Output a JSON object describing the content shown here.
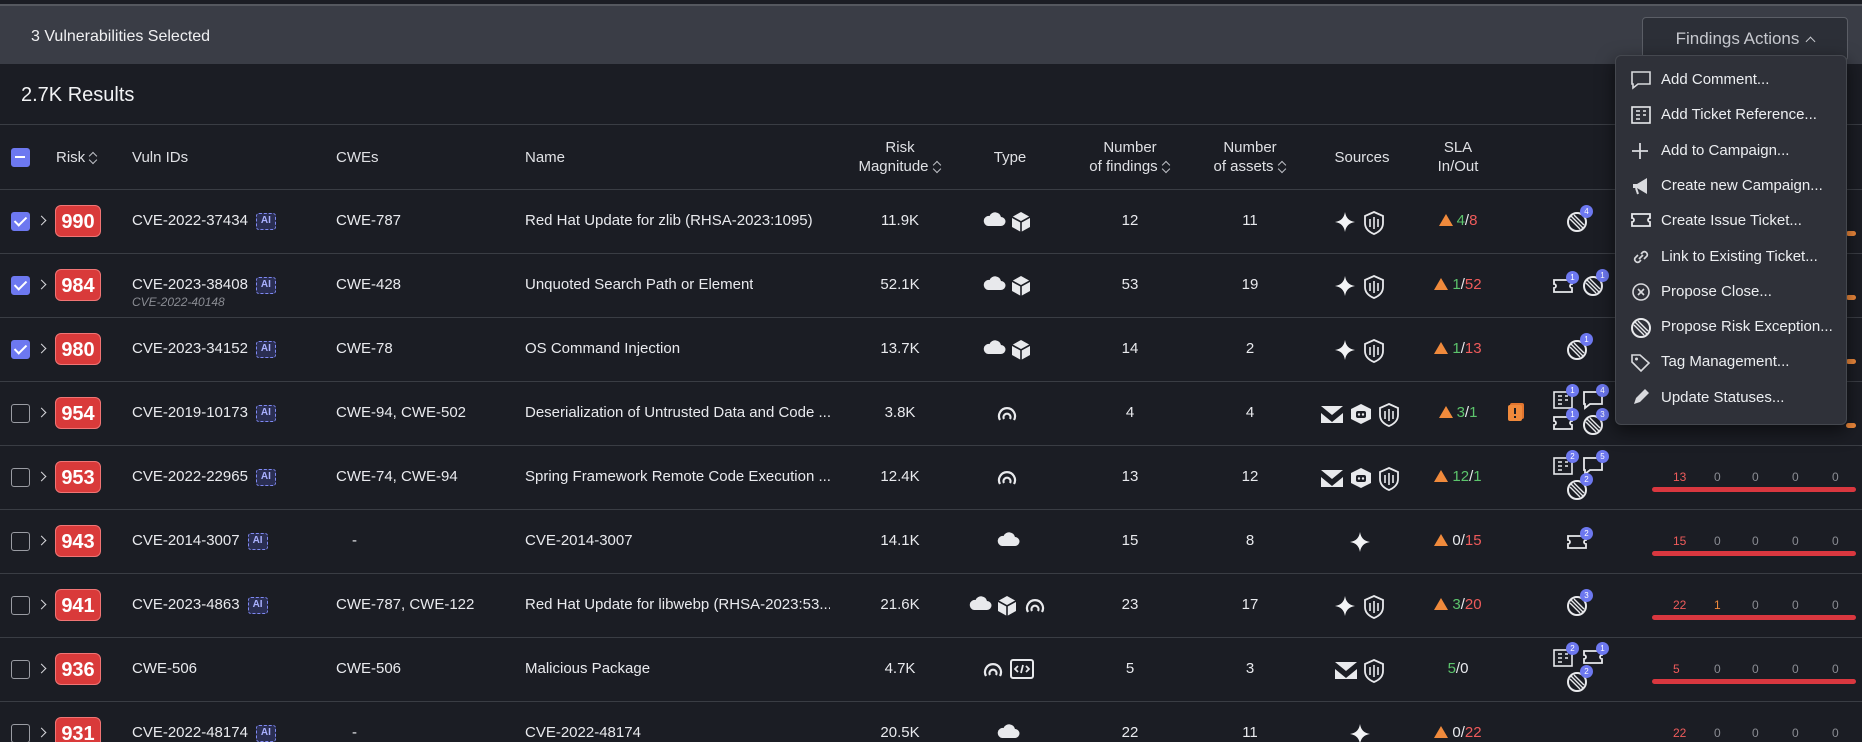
{
  "selection_bar": {
    "text": "3 Vulnerabilities Selected",
    "actions_label": "Findings Actions"
  },
  "results_label": "2.7K Results",
  "columns": {
    "risk": "Risk",
    "vuln_ids": "Vuln IDs",
    "cwes": "CWEs",
    "name": "Name",
    "risk_magnitude_1": "Risk",
    "risk_magnitude_2": "Magnitude",
    "type": "Type",
    "findings_1": "Number",
    "findings_2": "of findings",
    "assets_1": "Number",
    "assets_2": "of assets",
    "sources": "Sources",
    "sla_1": "SLA",
    "sla_2": "In/Out"
  },
  "menu": [
    {
      "label": "Add Comment...",
      "icon": "comment-icon"
    },
    {
      "label": "Add Ticket Reference...",
      "icon": "ticket-reference-icon"
    },
    {
      "label": "Add to Campaign...",
      "icon": "plus-icon"
    },
    {
      "label": "Create new Campaign...",
      "icon": "megaphone-icon"
    },
    {
      "label": "Create Issue Ticket...",
      "icon": "ticket-icon"
    },
    {
      "label": "Link to Existing Ticket...",
      "icon": "link-icon"
    },
    {
      "label": "Propose Close...",
      "icon": "close-circle-icon"
    },
    {
      "label": "Propose Risk Exception...",
      "icon": "risk-exception-icon"
    },
    {
      "label": "Tag Management...",
      "icon": "tag-icon"
    },
    {
      "label": "Update Statuses...",
      "icon": "pencil-icon"
    }
  ],
  "rows": [
    {
      "risk": "990",
      "vuln_id": "CVE-2022-37434",
      "alt_id": "",
      "cwes": "CWE-787",
      "name": "Red Hat Update for zlib (RHSA-2023:1095)",
      "magnitude": "11.9K",
      "findings": "12",
      "assets": "11",
      "sla_in": "4",
      "sla_out": "8",
      "checked": true
    },
    {
      "risk": "984",
      "vuln_id": "CVE-2023-38408",
      "alt_id": "CVE-2022-40148",
      "cwes": "CWE-428",
      "name": "Unquoted Search Path or Element",
      "magnitude": "52.1K",
      "findings": "53",
      "assets": "19",
      "sla_in": "1",
      "sla_out": "52",
      "checked": true
    },
    {
      "risk": "980",
      "vuln_id": "CVE-2023-34152",
      "alt_id": "",
      "cwes": "CWE-78",
      "name": "OS Command Injection",
      "magnitude": "13.7K",
      "findings": "14",
      "assets": "2",
      "sla_in": "1",
      "sla_out": "13",
      "checked": true
    },
    {
      "risk": "954",
      "vuln_id": "CVE-2019-10173",
      "alt_id": "",
      "cwes": "CWE-94, CWE-502",
      "name": "Deserialization of Untrusted Data and Code ...",
      "magnitude": "3.8K",
      "findings": "4",
      "assets": "4",
      "sla_in": "3",
      "sla_out": "1",
      "checked": false
    },
    {
      "risk": "953",
      "vuln_id": "CVE-2022-22965",
      "alt_id": "",
      "cwes": "CWE-74, CWE-94",
      "name": "Spring Framework Remote Code Execution ...",
      "magnitude": "12.4K",
      "findings": "13",
      "assets": "12",
      "sla_in": "12",
      "sla_out": "1",
      "checked": false,
      "bars": [
        "13",
        "0",
        "0",
        "0",
        "0"
      ]
    },
    {
      "risk": "943",
      "vuln_id": "CVE-2014-3007",
      "alt_id": "",
      "cwes": "-",
      "name": "CVE-2014-3007",
      "magnitude": "14.1K",
      "findings": "15",
      "assets": "8",
      "sla_in": "0",
      "sla_out": "15",
      "checked": false,
      "bars": [
        "15",
        "0",
        "0",
        "0",
        "0"
      ]
    },
    {
      "risk": "941",
      "vuln_id": "CVE-2023-4863",
      "alt_id": "",
      "cwes": "CWE-787, CWE-122",
      "name": "Red Hat Update for libwebp (RHSA-2023:53...",
      "magnitude": "21.6K",
      "findings": "23",
      "assets": "17",
      "sla_in": "3",
      "sla_out": "20",
      "checked": false,
      "bars": [
        "22",
        "1",
        "0",
        "0",
        "0"
      ]
    },
    {
      "risk": "936",
      "vuln_id": "CWE-506",
      "alt_id": "",
      "cwes": "CWE-506",
      "name": "Malicious Package",
      "magnitude": "4.7K",
      "findings": "5",
      "assets": "3",
      "sla_in": "5",
      "sla_out": "0",
      "checked": false,
      "bars": [
        "5",
        "0",
        "0",
        "0",
        "0"
      ]
    },
    {
      "risk": "931",
      "vuln_id": "CVE-2022-48174",
      "alt_id": "",
      "cwes": "-",
      "name": "CVE-2022-48174",
      "magnitude": "20.5K",
      "findings": "22",
      "assets": "11",
      "sla_in": "0",
      "sla_out": "22",
      "checked": false,
      "bars": [
        "22",
        "0",
        "0",
        "0",
        "0"
      ]
    }
  ],
  "bubbles": {
    "r0": [
      "4"
    ],
    "r1": [
      "1",
      "1"
    ],
    "r2": [
      "1"
    ],
    "r3": [
      "1",
      "4",
      "1",
      "3"
    ],
    "r4": [
      "2",
      "5",
      "2"
    ],
    "r5": [
      "2"
    ],
    "r6": [
      "3"
    ],
    "r7": [
      "2",
      "1",
      "2"
    ]
  },
  "colors": {
    "accent": "#6d78f0",
    "risk_red": "#d93a3a",
    "sla_green": "#5cc46c",
    "sla_red": "#ef5b5b",
    "warning": "#f08a3c"
  }
}
